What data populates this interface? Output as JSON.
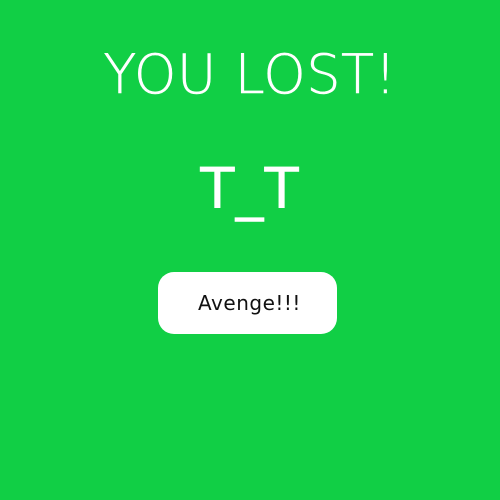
{
  "game_over": {
    "title": "YOU LOST!",
    "face": "T_T",
    "button_label": "Avenge!!!"
  },
  "colors": {
    "background": "#11cf45",
    "text": "#ffffff",
    "button_bg": "#ffffff",
    "button_text": "#111111"
  }
}
